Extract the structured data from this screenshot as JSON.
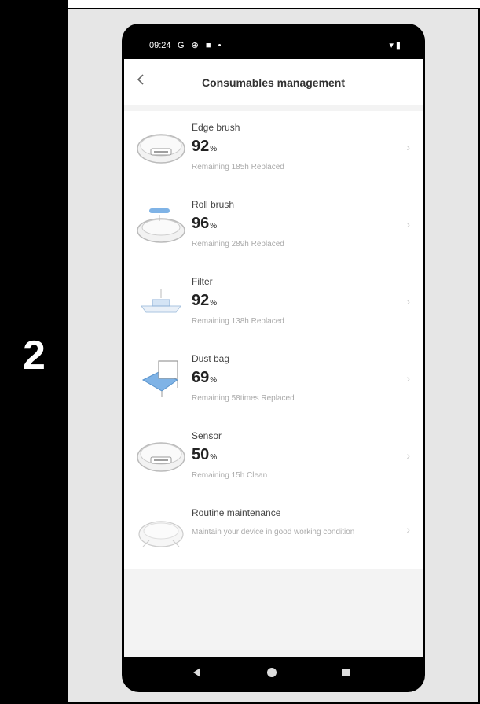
{
  "step": {
    "number": "2"
  },
  "status_bar": {
    "time": "09:24",
    "left_icons": "G ⊕ ■ •",
    "right_icons": "▾ ▮"
  },
  "header": {
    "title": "Consumables management",
    "back_icon": "chevron-left-icon"
  },
  "items": [
    {
      "name": "Edge brush",
      "percent": "92",
      "unit": "%",
      "detail": "Remaining 185h Replaced",
      "icon": "robot-vacuum-icon"
    },
    {
      "name": "Roll brush",
      "percent": "96",
      "unit": "%",
      "detail": "Remaining 289h Replaced",
      "icon": "roll-brush-icon"
    },
    {
      "name": "Filter",
      "percent": "92",
      "unit": "%",
      "detail": "Remaining 138h Replaced",
      "icon": "filter-icon"
    },
    {
      "name": "Dust bag",
      "percent": "69",
      "unit": "%",
      "detail": "Remaining 58times Replaced",
      "icon": "dust-bag-icon"
    },
    {
      "name": "Sensor",
      "percent": "50",
      "unit": "%",
      "detail": "Remaining 15h Clean",
      "icon": "sensor-icon"
    }
  ],
  "maintenance": {
    "name": "Routine maintenance",
    "description": "Maintain your device in good working condition",
    "icon": "maintenance-icon"
  },
  "colors": {
    "frame": "#000000",
    "panel": "#e6e6e6",
    "screen_bg": "#ffffff",
    "muted_text": "#aaaaaa"
  }
}
